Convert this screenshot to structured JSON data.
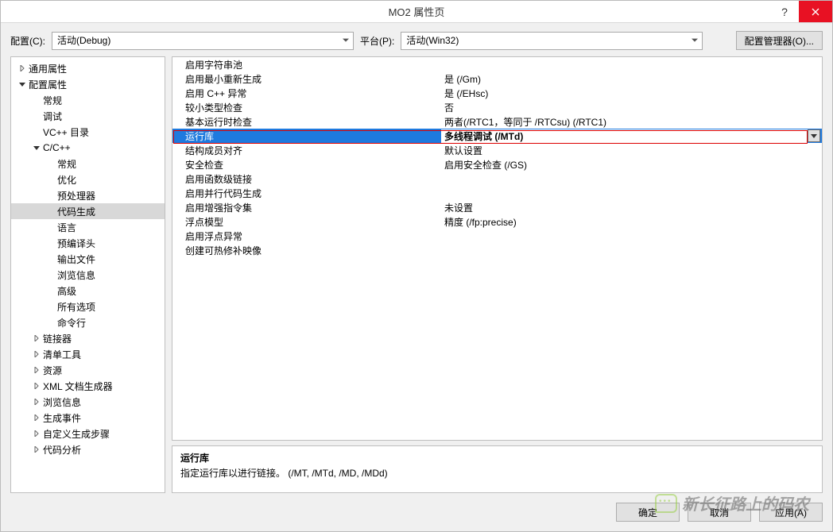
{
  "window": {
    "title": "MO2 属性页"
  },
  "configRow": {
    "configLabel": "配置(C):",
    "configValue": "活动(Debug)",
    "platformLabel": "平台(P):",
    "platformValue": "活动(Win32)",
    "managerButton": "配置管理器(O)..."
  },
  "tree": [
    {
      "label": "通用属性",
      "level": 0,
      "arrow": "right"
    },
    {
      "label": "配置属性",
      "level": 0,
      "arrow": "down"
    },
    {
      "label": "常规",
      "level": 1,
      "arrow": "blank"
    },
    {
      "label": "调试",
      "level": 1,
      "arrow": "blank"
    },
    {
      "label": "VC++ 目录",
      "level": 1,
      "arrow": "blank"
    },
    {
      "label": "C/C++",
      "level": 1,
      "arrow": "down"
    },
    {
      "label": "常规",
      "level": 2,
      "arrow": "blank"
    },
    {
      "label": "优化",
      "level": 2,
      "arrow": "blank"
    },
    {
      "label": "预处理器",
      "level": 2,
      "arrow": "blank"
    },
    {
      "label": "代码生成",
      "level": 2,
      "arrow": "blank",
      "selected": true
    },
    {
      "label": "语言",
      "level": 2,
      "arrow": "blank"
    },
    {
      "label": "预编译头",
      "level": 2,
      "arrow": "blank"
    },
    {
      "label": "输出文件",
      "level": 2,
      "arrow": "blank"
    },
    {
      "label": "浏览信息",
      "level": 2,
      "arrow": "blank"
    },
    {
      "label": "高级",
      "level": 2,
      "arrow": "blank"
    },
    {
      "label": "所有选项",
      "level": 2,
      "arrow": "blank"
    },
    {
      "label": "命令行",
      "level": 2,
      "arrow": "blank"
    },
    {
      "label": "链接器",
      "level": 1,
      "arrow": "right"
    },
    {
      "label": "清单工具",
      "level": 1,
      "arrow": "right"
    },
    {
      "label": "资源",
      "level": 1,
      "arrow": "right"
    },
    {
      "label": "XML 文档生成器",
      "level": 1,
      "arrow": "right"
    },
    {
      "label": "浏览信息",
      "level": 1,
      "arrow": "right"
    },
    {
      "label": "生成事件",
      "level": 1,
      "arrow": "right"
    },
    {
      "label": "自定义生成步骤",
      "level": 1,
      "arrow": "right"
    },
    {
      "label": "代码分析",
      "level": 1,
      "arrow": "right"
    }
  ],
  "props": [
    {
      "label": "启用字符串池",
      "value": ""
    },
    {
      "label": "启用最小重新生成",
      "value": "是 (/Gm)"
    },
    {
      "label": "启用 C++ 异常",
      "value": "是 (/EHsc)"
    },
    {
      "label": "较小类型检查",
      "value": "否"
    },
    {
      "label": "基本运行时检查",
      "value": "两者(/RTC1，等同于 /RTCsu) (/RTC1)"
    },
    {
      "label": "运行库",
      "value": "多线程调试 (/MTd)",
      "selected": true
    },
    {
      "label": "结构成员对齐",
      "value": "默认设置"
    },
    {
      "label": "安全检查",
      "value": "启用安全检查 (/GS)"
    },
    {
      "label": "启用函数级链接",
      "value": ""
    },
    {
      "label": "启用并行代码生成",
      "value": ""
    },
    {
      "label": "启用增强指令集",
      "value": "未设置"
    },
    {
      "label": "浮点模型",
      "value": "精度 (/fp:precise)"
    },
    {
      "label": "启用浮点异常",
      "value": ""
    },
    {
      "label": "创建可热修补映像",
      "value": ""
    }
  ],
  "description": {
    "title": "运行库",
    "body": "指定运行库以进行链接。         (/MT, /MTd, /MD, /MDd)"
  },
  "buttons": {
    "ok": "确定",
    "cancel": "取消",
    "apply": "应用(A)"
  },
  "watermark": "新长征路上的码农"
}
